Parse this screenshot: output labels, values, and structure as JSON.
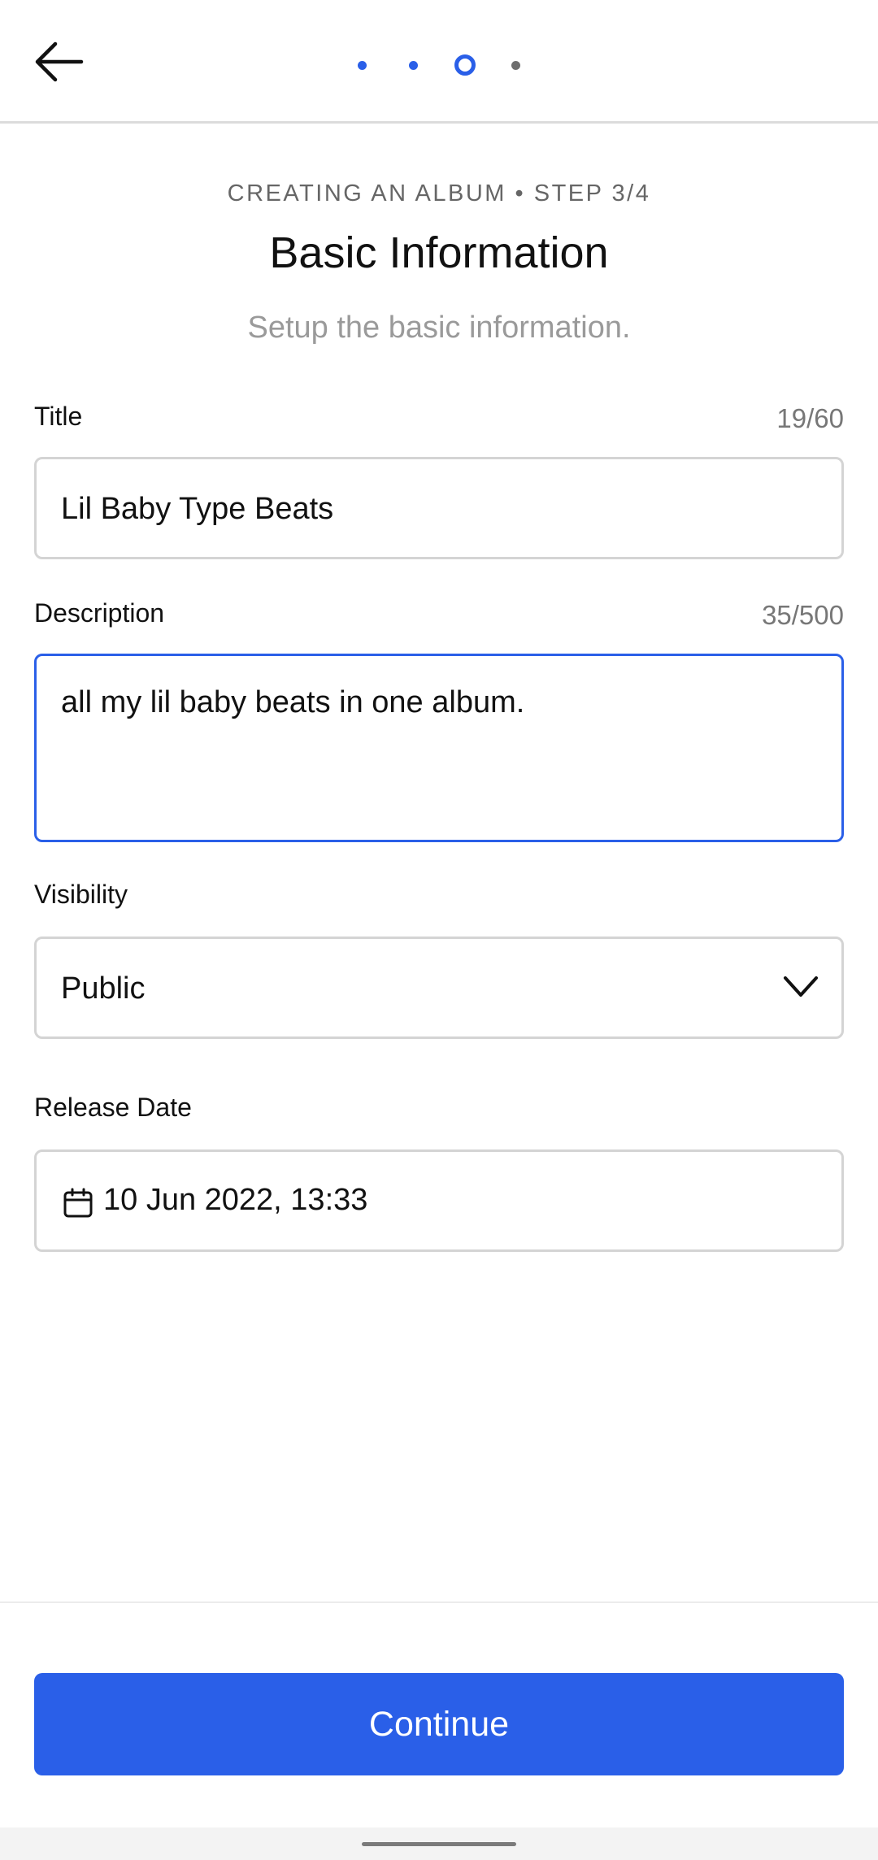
{
  "header": {
    "back_icon": "arrow-left-icon",
    "steps": [
      "done",
      "done",
      "current",
      "todo"
    ],
    "current_step": 3,
    "total_steps": 4
  },
  "intro": {
    "caption": "CREATING AN ALBUM • STEP 3/4",
    "title": "Basic Information",
    "subtitle": "Setup the basic information."
  },
  "form": {
    "title": {
      "label": "Title",
      "counter": "19/60",
      "value": "Lil Baby Type Beats"
    },
    "description": {
      "label": "Description",
      "counter": "35/500",
      "value": "all my lil baby beats in one album."
    },
    "visibility": {
      "label": "Visibility",
      "value": "Public",
      "icon": "chevron-down-icon"
    },
    "release_date": {
      "label": "Release Date",
      "value": "10 Jun 2022, 13:33",
      "icon": "calendar-icon"
    }
  },
  "footer": {
    "continue_label": "Continue"
  },
  "colors": {
    "accent": "#2a5fe8",
    "border": "#d4d4d4",
    "muted_text": "#9a9a9a"
  }
}
